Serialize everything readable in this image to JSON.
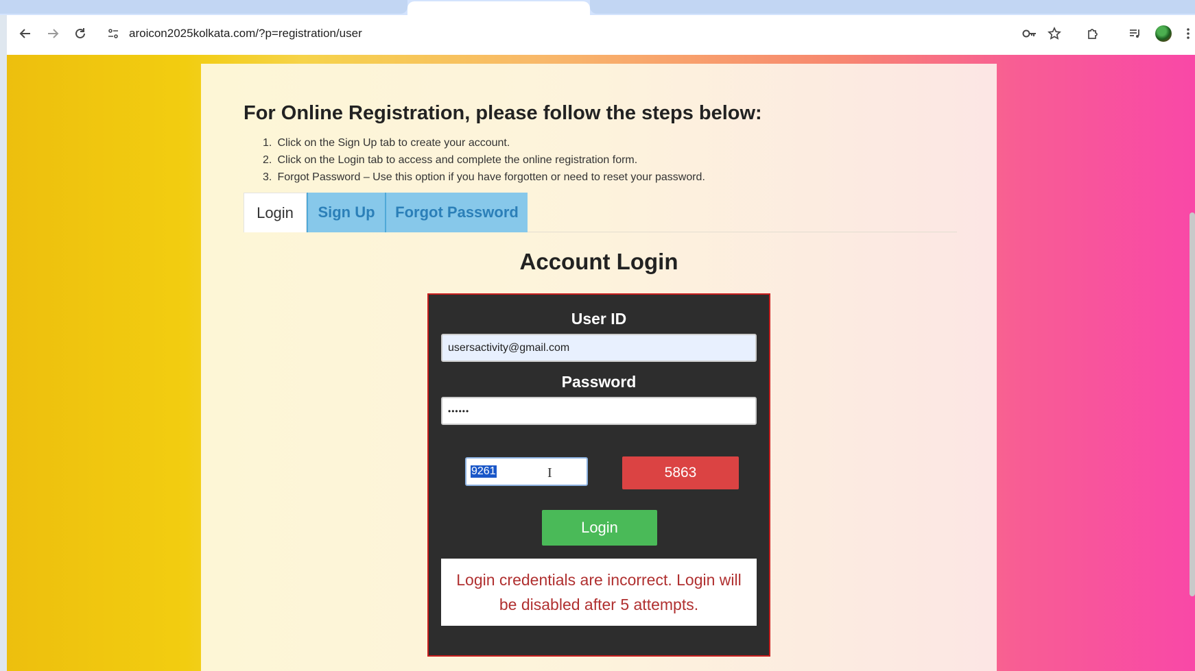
{
  "browser": {
    "url": "aroicon2025kolkata.com/?p=registration/user",
    "icons": {
      "back": "arrow-left-icon",
      "forward": "arrow-right-icon",
      "reload": "reload-icon",
      "site_info": "tune-icon",
      "password_key": "key-icon",
      "bookmark": "star-icon",
      "extensions": "puzzle-icon",
      "media": "queue-music-icon",
      "menu": "kebab-menu-icon"
    }
  },
  "intro": {
    "title": "For Online Registration, please follow the steps below:",
    "steps": [
      {
        "num": "1.",
        "text": "Click on the Sign Up tab to create your account."
      },
      {
        "num": "2.",
        "text": "Click on the Login tab to access and complete the online registration form."
      },
      {
        "num": "3.",
        "text": "Forgot Password – Use this option if you have forgotten or need to reset your password."
      }
    ]
  },
  "tabs": {
    "login": "Login",
    "signup": "Sign Up",
    "forgot": "Forgot Password"
  },
  "form": {
    "heading": "Account Login",
    "userid_label": "User ID",
    "userid_value": "usersactivity@gmail.com",
    "password_label": "Password",
    "password_value": "••••••",
    "captcha_input_value": "9261",
    "captcha_code": "5863",
    "login_button": "Login",
    "error_message": "Login credentials are incorrect. Login will be disabled after 5 attempts."
  },
  "colors": {
    "tab_accent": "#87c8ea",
    "captcha_bg": "#db4343",
    "login_button_bg": "#4aba58",
    "error_text": "#b03030",
    "login_box_border": "#c81e1e"
  }
}
